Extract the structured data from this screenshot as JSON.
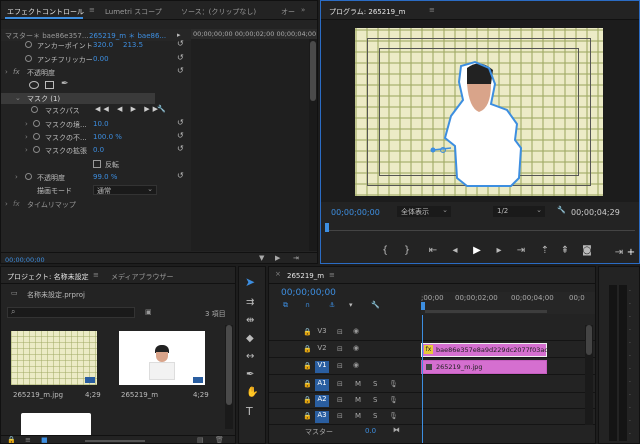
{
  "effect_controls": {
    "tabs": [
      "エフェクトコントロール",
      "Lumetri スコープ",
      "ソース：(クリップなし)",
      "オー"
    ],
    "master_label": "マスター＊ bae86e357...",
    "clip_label": "265219_m ＊ bae86...",
    "ruler_time": "00;00;00;00 00;00;02;00 00;00;04;00",
    "rows": {
      "anchor": {
        "label": "アンカーポイント",
        "v1": "320.0",
        "v2": "213.5"
      },
      "antiflicker": {
        "label": "アンチフリッカー",
        "v1": "0.00"
      },
      "opacity_group": "不透明度",
      "mask": "マスク (1)",
      "mask_path": "マスクパス",
      "mask_feather": {
        "label": "マスクの境...",
        "v1": "10.0"
      },
      "mask_opacity": {
        "label": "マスクの不...",
        "v1": "100.0 %"
      },
      "mask_expansion": {
        "label": "マスクの拡張",
        "v1": "0.0"
      },
      "invert": "反転",
      "opacity": {
        "label": "不透明度",
        "v1": "99.0 %"
      },
      "blend": {
        "label": "描画モード",
        "v1": "通常"
      },
      "timeremap": "タイムリマップ"
    },
    "footer_time": "00;00;00;00"
  },
  "program": {
    "tab": "プログラム: 265219_m",
    "timecode": "00;00;00;00",
    "fit": "全体表示",
    "resolution": "1/2",
    "duration": "00;00;04;29"
  },
  "project": {
    "tabs": [
      "プロジェクト: 名称未設定",
      "メディアブラウザー"
    ],
    "filename": "名称未設定.prproj",
    "search_placeholder": "",
    "count": "3 項目",
    "items": [
      {
        "name": "265219_m.jpg",
        "dur": "4;29"
      },
      {
        "name": "265219_m",
        "dur": "4;29"
      }
    ]
  },
  "timeline": {
    "tab": "265219_m",
    "timecode": "00;00;00;00",
    "ruler": [
      ";00;00",
      "00;00;02;00",
      "00;00;04;00",
      "00;0"
    ],
    "video_tracks": [
      {
        "name": "V3"
      },
      {
        "name": "V2",
        "clip": "bae86e357e8a9d229dc2077f03ad"
      },
      {
        "name": "V1",
        "clip": "265219_m.jpg"
      }
    ],
    "audio_tracks": [
      {
        "name": "A1"
      },
      {
        "name": "A2"
      },
      {
        "name": "A3"
      }
    ],
    "master": {
      "label": "マスター",
      "value": "0.0"
    },
    "m_label": "M",
    "s_label": "S"
  },
  "colors": {
    "accent": "#3d8ee0",
    "clip": "#d56fd0",
    "panel": "#232323"
  }
}
